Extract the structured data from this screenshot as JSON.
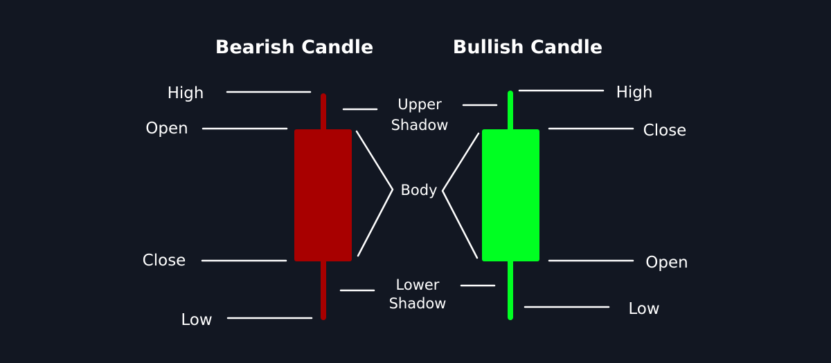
{
  "colors": {
    "background": "#121722",
    "text": "#ffffff",
    "line": "#ffffff",
    "bearish": "#a80000",
    "bullish": "#00ff22"
  },
  "bearish": {
    "title": "Bearish Candle",
    "high_label": "High",
    "open_label": "Open",
    "close_label": "Close",
    "low_label": "Low"
  },
  "bullish": {
    "title": "Bullish Candle",
    "high_label": "High",
    "close_label": "Close",
    "open_label": "Open",
    "low_label": "Low"
  },
  "center": {
    "upper_shadow_line1": "Upper",
    "upper_shadow_line2": "Shadow",
    "body_label": "Body",
    "lower_shadow_line1": "Lower",
    "lower_shadow_line2": "Shadow"
  }
}
